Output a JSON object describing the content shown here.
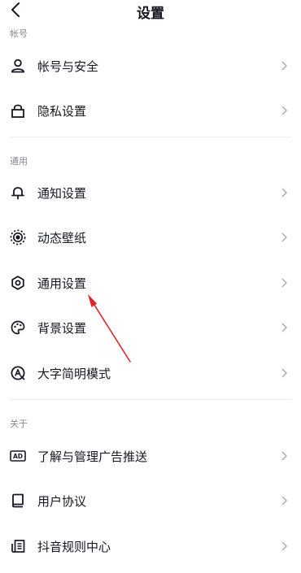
{
  "header": {
    "title": "设置"
  },
  "sections": {
    "account": {
      "label": "帐号",
      "items": [
        {
          "label": "帐号与安全",
          "icon": "user-icon"
        },
        {
          "label": "隐私设置",
          "icon": "lock-icon"
        }
      ]
    },
    "general": {
      "label": "通用",
      "items": [
        {
          "label": "通知设置",
          "icon": "bell-icon"
        },
        {
          "label": "动态壁纸",
          "icon": "live-wallpaper-icon"
        },
        {
          "label": "通用设置",
          "icon": "gear-icon"
        },
        {
          "label": "背景设置",
          "icon": "palette-icon"
        },
        {
          "label": "大字简明模式",
          "icon": "large-font-icon"
        }
      ]
    },
    "about": {
      "label": "关于",
      "items": [
        {
          "label": "了解与管理广告推送",
          "icon": "ad-icon"
        },
        {
          "label": "用户协议",
          "icon": "book-icon"
        },
        {
          "label": "抖音规则中心",
          "icon": "rules-icon"
        }
      ]
    }
  },
  "colors": {
    "text": "#161823",
    "muted": "#8a8b91",
    "chevron": "#a4a5aa",
    "divider": "#eeeef0",
    "annotation_arrow": "#e0242b"
  }
}
